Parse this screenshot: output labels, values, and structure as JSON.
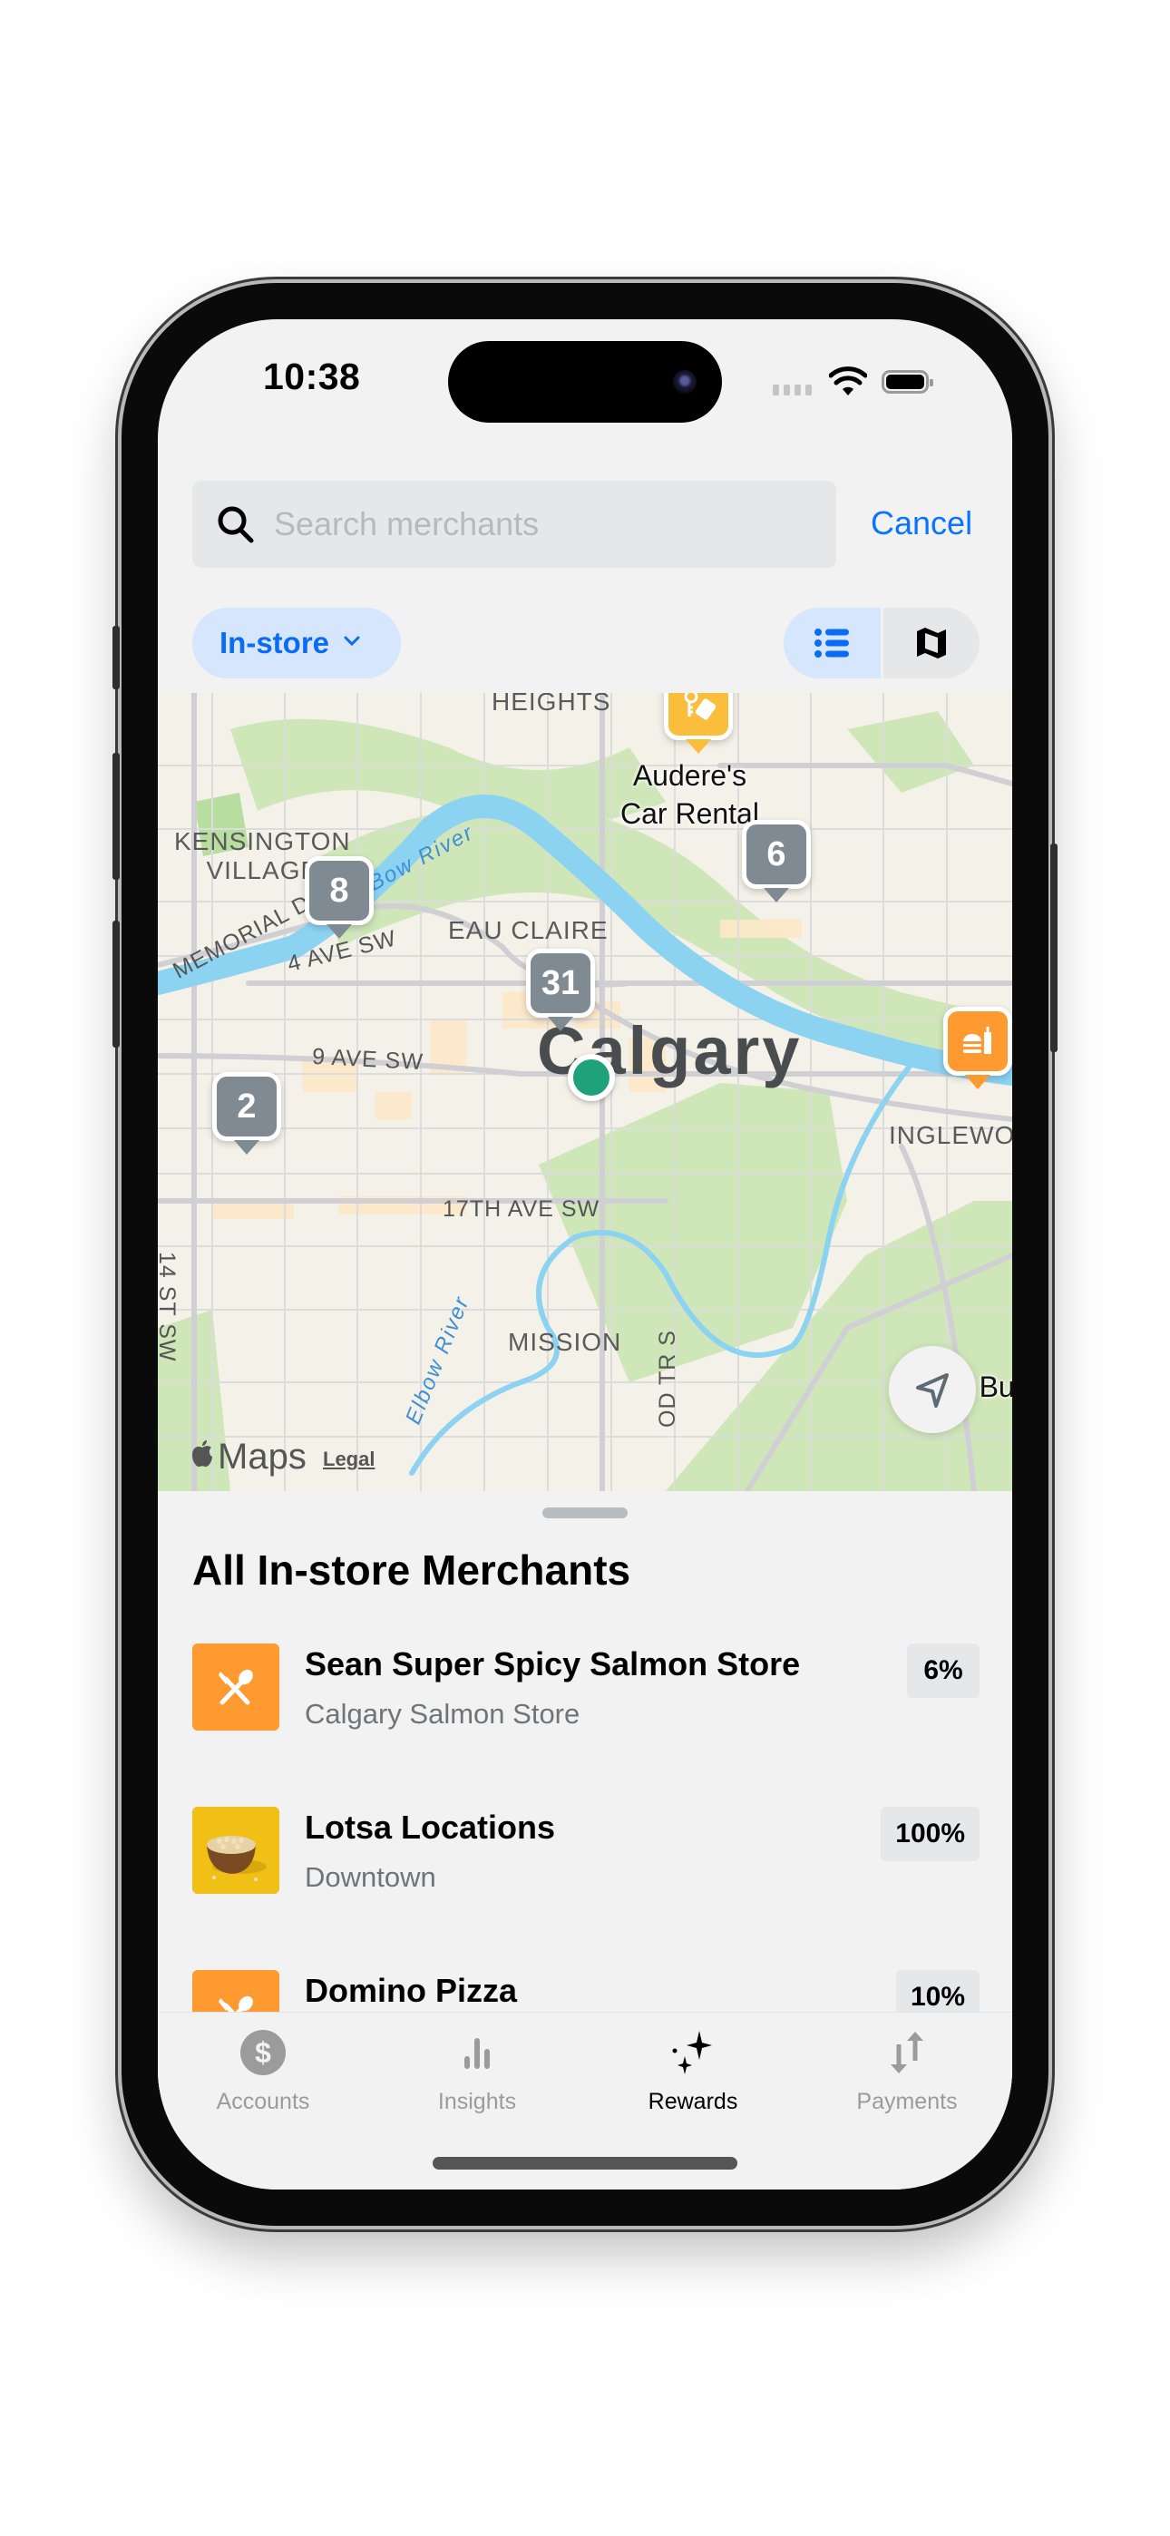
{
  "status_bar": {
    "time": "10:38"
  },
  "search": {
    "placeholder": "Search merchants",
    "value": "",
    "cancel_label": "Cancel"
  },
  "filters": {
    "selected": "In-store",
    "view_modes": [
      "list",
      "map"
    ],
    "active_view": "list"
  },
  "map": {
    "city_label": "Calgary",
    "neighborhoods": [
      "HEIGHTS",
      "KENSINGTON\nVILLAGE",
      "EAU CLAIRE",
      "MISSION",
      "INGLEWOOD"
    ],
    "streets": [
      "MEMORIAL DR",
      "4 AVE SW",
      "9 AVE SW",
      "17TH AVE SW",
      "14 ST SW",
      "OD TR S"
    ],
    "rivers": [
      "Bow River",
      "Elbow River"
    ],
    "poi": [
      {
        "name": "Audere's\nCar Rental",
        "icon": "car-rental-key-icon",
        "color": "#fbbd3c"
      },
      {
        "name": "Krusty Bu",
        "icon": "fast-food-icon",
        "color": "#fe9a30"
      }
    ],
    "clusters": [
      "8",
      "6",
      "31",
      "2"
    ],
    "attribution": "Maps",
    "legal_label": "Legal"
  },
  "sheet": {
    "title": "All In-store Merchants",
    "merchants": [
      {
        "name": "Sean Super Spicy Salmon Store",
        "location": "Calgary Salmon Store",
        "reward": "6%",
        "thumb": "restaurant-icon"
      },
      {
        "name": "Lotsa Locations",
        "location": "Downtown",
        "reward": "100%",
        "thumb": "food-bowl-photo"
      },
      {
        "name": "Domino Pizza",
        "location": "",
        "reward": "10%",
        "thumb": "restaurant-icon"
      }
    ]
  },
  "tabbar": {
    "items": [
      {
        "label": "Accounts",
        "icon": "dollar-circle-icon",
        "active": false
      },
      {
        "label": "Insights",
        "icon": "bar-chart-icon",
        "active": false
      },
      {
        "label": "Rewards",
        "icon": "sparkles-icon",
        "active": true
      },
      {
        "label": "Payments",
        "icon": "transfer-arrows-icon",
        "active": false
      }
    ]
  },
  "colors": {
    "accent": "#0a74ff",
    "accent_bg": "#d6e6fd",
    "user_location": "#1fa27a",
    "cluster": "#808a93",
    "restaurant_orange": "#fe9a30"
  }
}
